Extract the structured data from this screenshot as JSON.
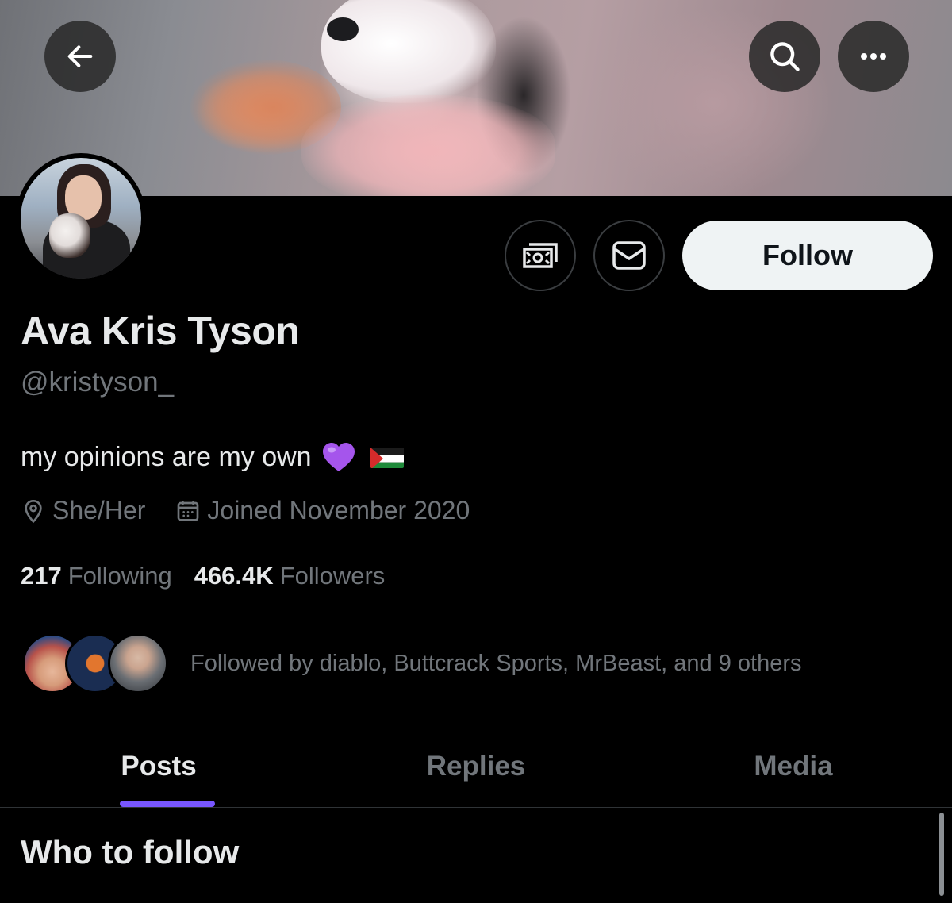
{
  "header": {
    "back_icon": "arrow-left-icon",
    "search_icon": "search-icon",
    "more_icon": "more-horizontal-icon"
  },
  "profile": {
    "display_name": "Ava Kris Tyson",
    "handle": "@kristyson_",
    "bio_text": "my opinions are my own",
    "bio_emojis": [
      "purple-heart",
      "palestine-flag"
    ],
    "pronouns": "She/Her",
    "joined": "Joined November 2020",
    "following_count": "217",
    "following_label": "Following",
    "followers_count": "466.4K",
    "followers_label": "Followers",
    "followed_by_text": "Followed by diablo, Buttcrack Sports, MrBeast, and 9 others"
  },
  "actions": {
    "tip_icon": "money-icon",
    "message_icon": "envelope-icon",
    "follow_label": "Follow"
  },
  "tabs": [
    {
      "label": "Posts",
      "active": true
    },
    {
      "label": "Replies",
      "active": false
    },
    {
      "label": "Media",
      "active": false
    }
  ],
  "section": {
    "title": "Who to follow"
  },
  "colors": {
    "background": "#000000",
    "primary_text": "#e7e9ea",
    "secondary_text": "#71767b",
    "accent": "#7856ff",
    "follow_button_bg": "#eff3f4"
  }
}
